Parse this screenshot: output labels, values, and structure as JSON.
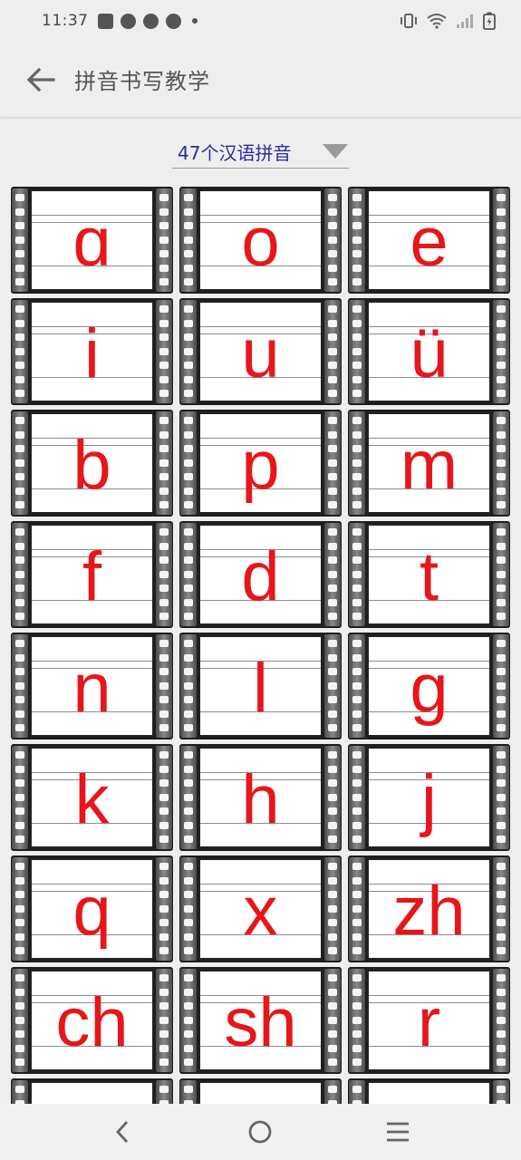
{
  "status_bar": {
    "time": "11:37",
    "left_icons": [
      "mail-icon",
      "app-notification-icon",
      "app-notification-icon",
      "app-notification-icon",
      "dot-icon"
    ],
    "right_icons": [
      "vibrate-icon",
      "wifi-icon",
      "signal-icon",
      "battery-charging-icon"
    ]
  },
  "app_bar": {
    "back_icon": "arrow-left-icon",
    "title": "拼音书写教学"
  },
  "spinner": {
    "selected": "47个汉语拼音",
    "arrow_icon": "triangle-down-icon"
  },
  "grid": {
    "items": [
      "ɑ",
      "o",
      "e",
      "i",
      "u",
      "ü",
      "b",
      "p",
      "m",
      "f",
      "d",
      "t",
      "n",
      "l",
      "g",
      "k",
      "h",
      "j",
      "q",
      "x",
      "zh",
      "ch",
      "sh",
      "r",
      "",
      "",
      ""
    ]
  },
  "colors": {
    "letter": "#e6161a",
    "spinner_text": "#2a2a9c",
    "background": "#eeeeee"
  },
  "nav_bar": {
    "icons": [
      "back-chevron-icon",
      "home-circle-icon",
      "menu-lines-icon"
    ]
  }
}
